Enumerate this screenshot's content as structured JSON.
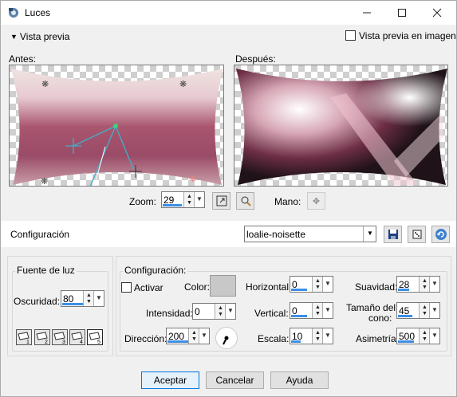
{
  "window": {
    "title": "Luces"
  },
  "preview": {
    "toggle_label": "Vista previa",
    "image_checkbox_label": "Vista previa en imagen",
    "before_label": "Antes:",
    "after_label": "Después:"
  },
  "zoom": {
    "label": "Zoom:",
    "value": "29",
    "hand_label": "Mano:"
  },
  "preset": {
    "label": "Configuración",
    "value": "loalie-noisette"
  },
  "light_source": {
    "group_label": "Fuente de luz",
    "darkness_label": "Oscuridad:",
    "darkness_value": "80",
    "lights": [
      "1",
      "2",
      "3",
      "4",
      "5"
    ]
  },
  "config": {
    "group_label": "Configuración:",
    "activate_label": "Activar",
    "color_label": "Color:",
    "intensity_label": "Intensidad:",
    "intensity_value": "0",
    "direction_label": "Dirección:",
    "direction_value": "200",
    "horizontal_label": "Horizontal:",
    "horizontal_value": "0",
    "vertical_label": "Vertical:",
    "vertical_value": "0",
    "scale_label": "Escala:",
    "scale_value": "10",
    "softness_label": "Suavidad:",
    "softness_value": "28",
    "cone_label_1": "Tamaño del",
    "cone_label_2": "cono:",
    "cone_value": "45",
    "asymmetry_label": "Asimetría:",
    "asymmetry_value": "500",
    "color_swatch": "#c8c8c8"
  },
  "buttons": {
    "ok": "Aceptar",
    "cancel": "Cancelar",
    "help": "Ayuda"
  },
  "colors": {
    "accent": "#3c8ee6",
    "pink": "#a0506e"
  }
}
